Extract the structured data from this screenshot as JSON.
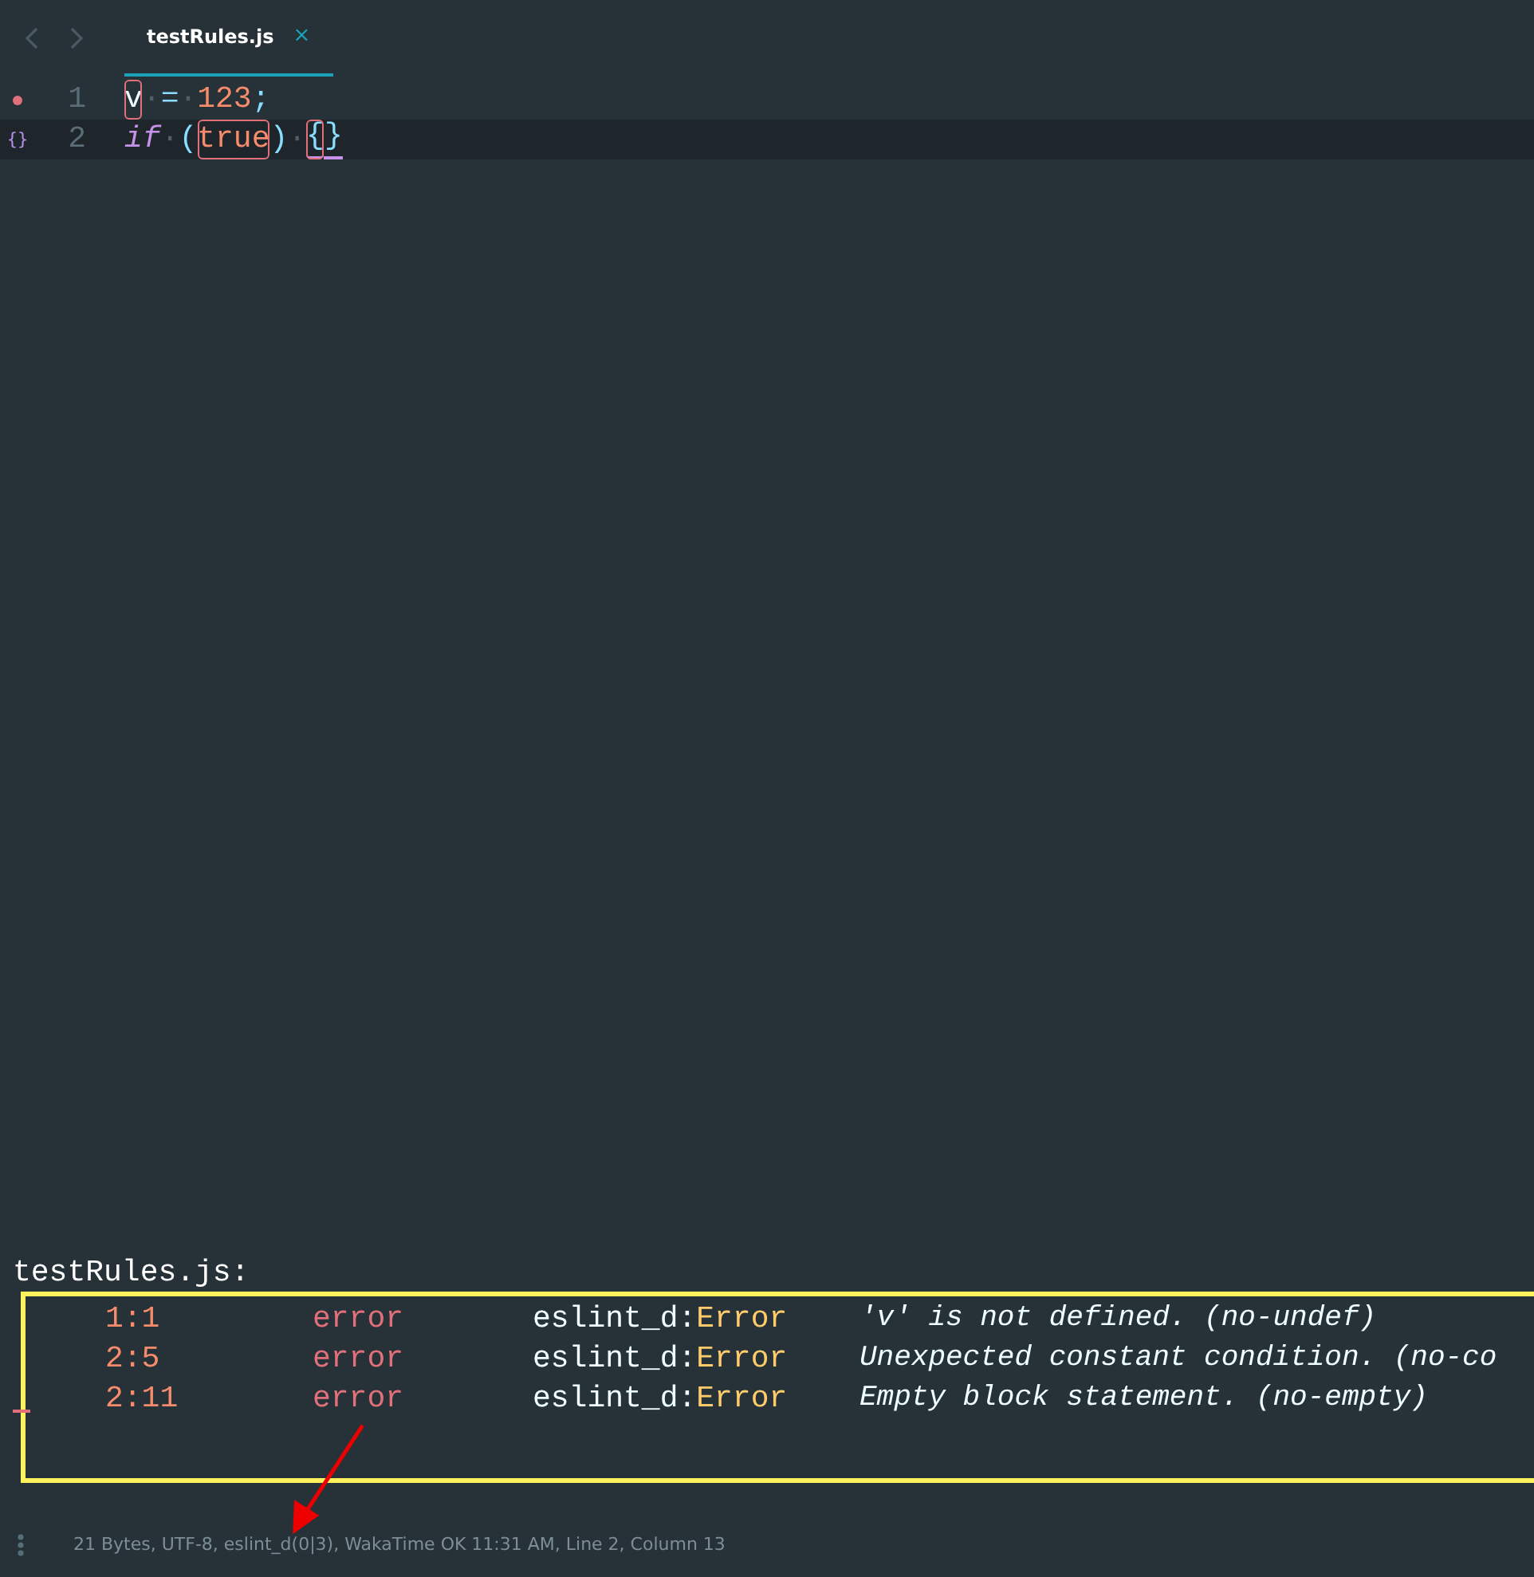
{
  "tabs": [
    {
      "label": "testRules.js",
      "selected": true,
      "close": "×"
    }
  ],
  "editor": {
    "lines": [
      {
        "number": "1",
        "current": false,
        "gutter": {
          "kind": "dot"
        },
        "tokens": [
          {
            "text": "v",
            "kind": "var",
            "flagged": true
          },
          {
            "text": "·",
            "kind": "ws"
          },
          {
            "text": "=",
            "kind": "op"
          },
          {
            "text": "·",
            "kind": "ws"
          },
          {
            "text": "123",
            "kind": "num"
          },
          {
            "text": ";",
            "kind": "punct"
          }
        ]
      },
      {
        "number": "2",
        "current": true,
        "gutter": {
          "kind": "glyph",
          "text": "{}"
        },
        "tokens": [
          {
            "text": "if",
            "kind": "keyword"
          },
          {
            "text": "·",
            "kind": "ws"
          },
          {
            "text": "(",
            "kind": "paren"
          },
          {
            "text": "true",
            "kind": "num",
            "flagged": true
          },
          {
            "text": ")",
            "kind": "paren"
          },
          {
            "text": "·",
            "kind": "ws"
          },
          {
            "text": "{",
            "kind": "brace",
            "flagged": true,
            "underlined": true
          },
          {
            "text": "}",
            "kind": "brace",
            "underlined": true
          }
        ]
      }
    ]
  },
  "problems": {
    "file": "testRules.js:",
    "rows": [
      {
        "location": "1:1",
        "severity": "error",
        "source": "eslint_d",
        "separator": ":",
        "type": "Error",
        "message": "'v' is not defined. (no-undef)"
      },
      {
        "location": "2:5",
        "severity": "error",
        "source": "eslint_d",
        "separator": ":",
        "type": "Error",
        "message": "Unexpected constant condition. (no-co"
      },
      {
        "location": "2:11",
        "severity": "error",
        "source": "eslint_d",
        "separator": ":",
        "type": "Error",
        "message": "Empty block statement. (no-empty)"
      }
    ]
  },
  "status_bar": {
    "text": "21 Bytes, UTF-8, eslint_d(0|3), WakaTime OK 11:31 AM, Line 2, Column 13"
  }
}
